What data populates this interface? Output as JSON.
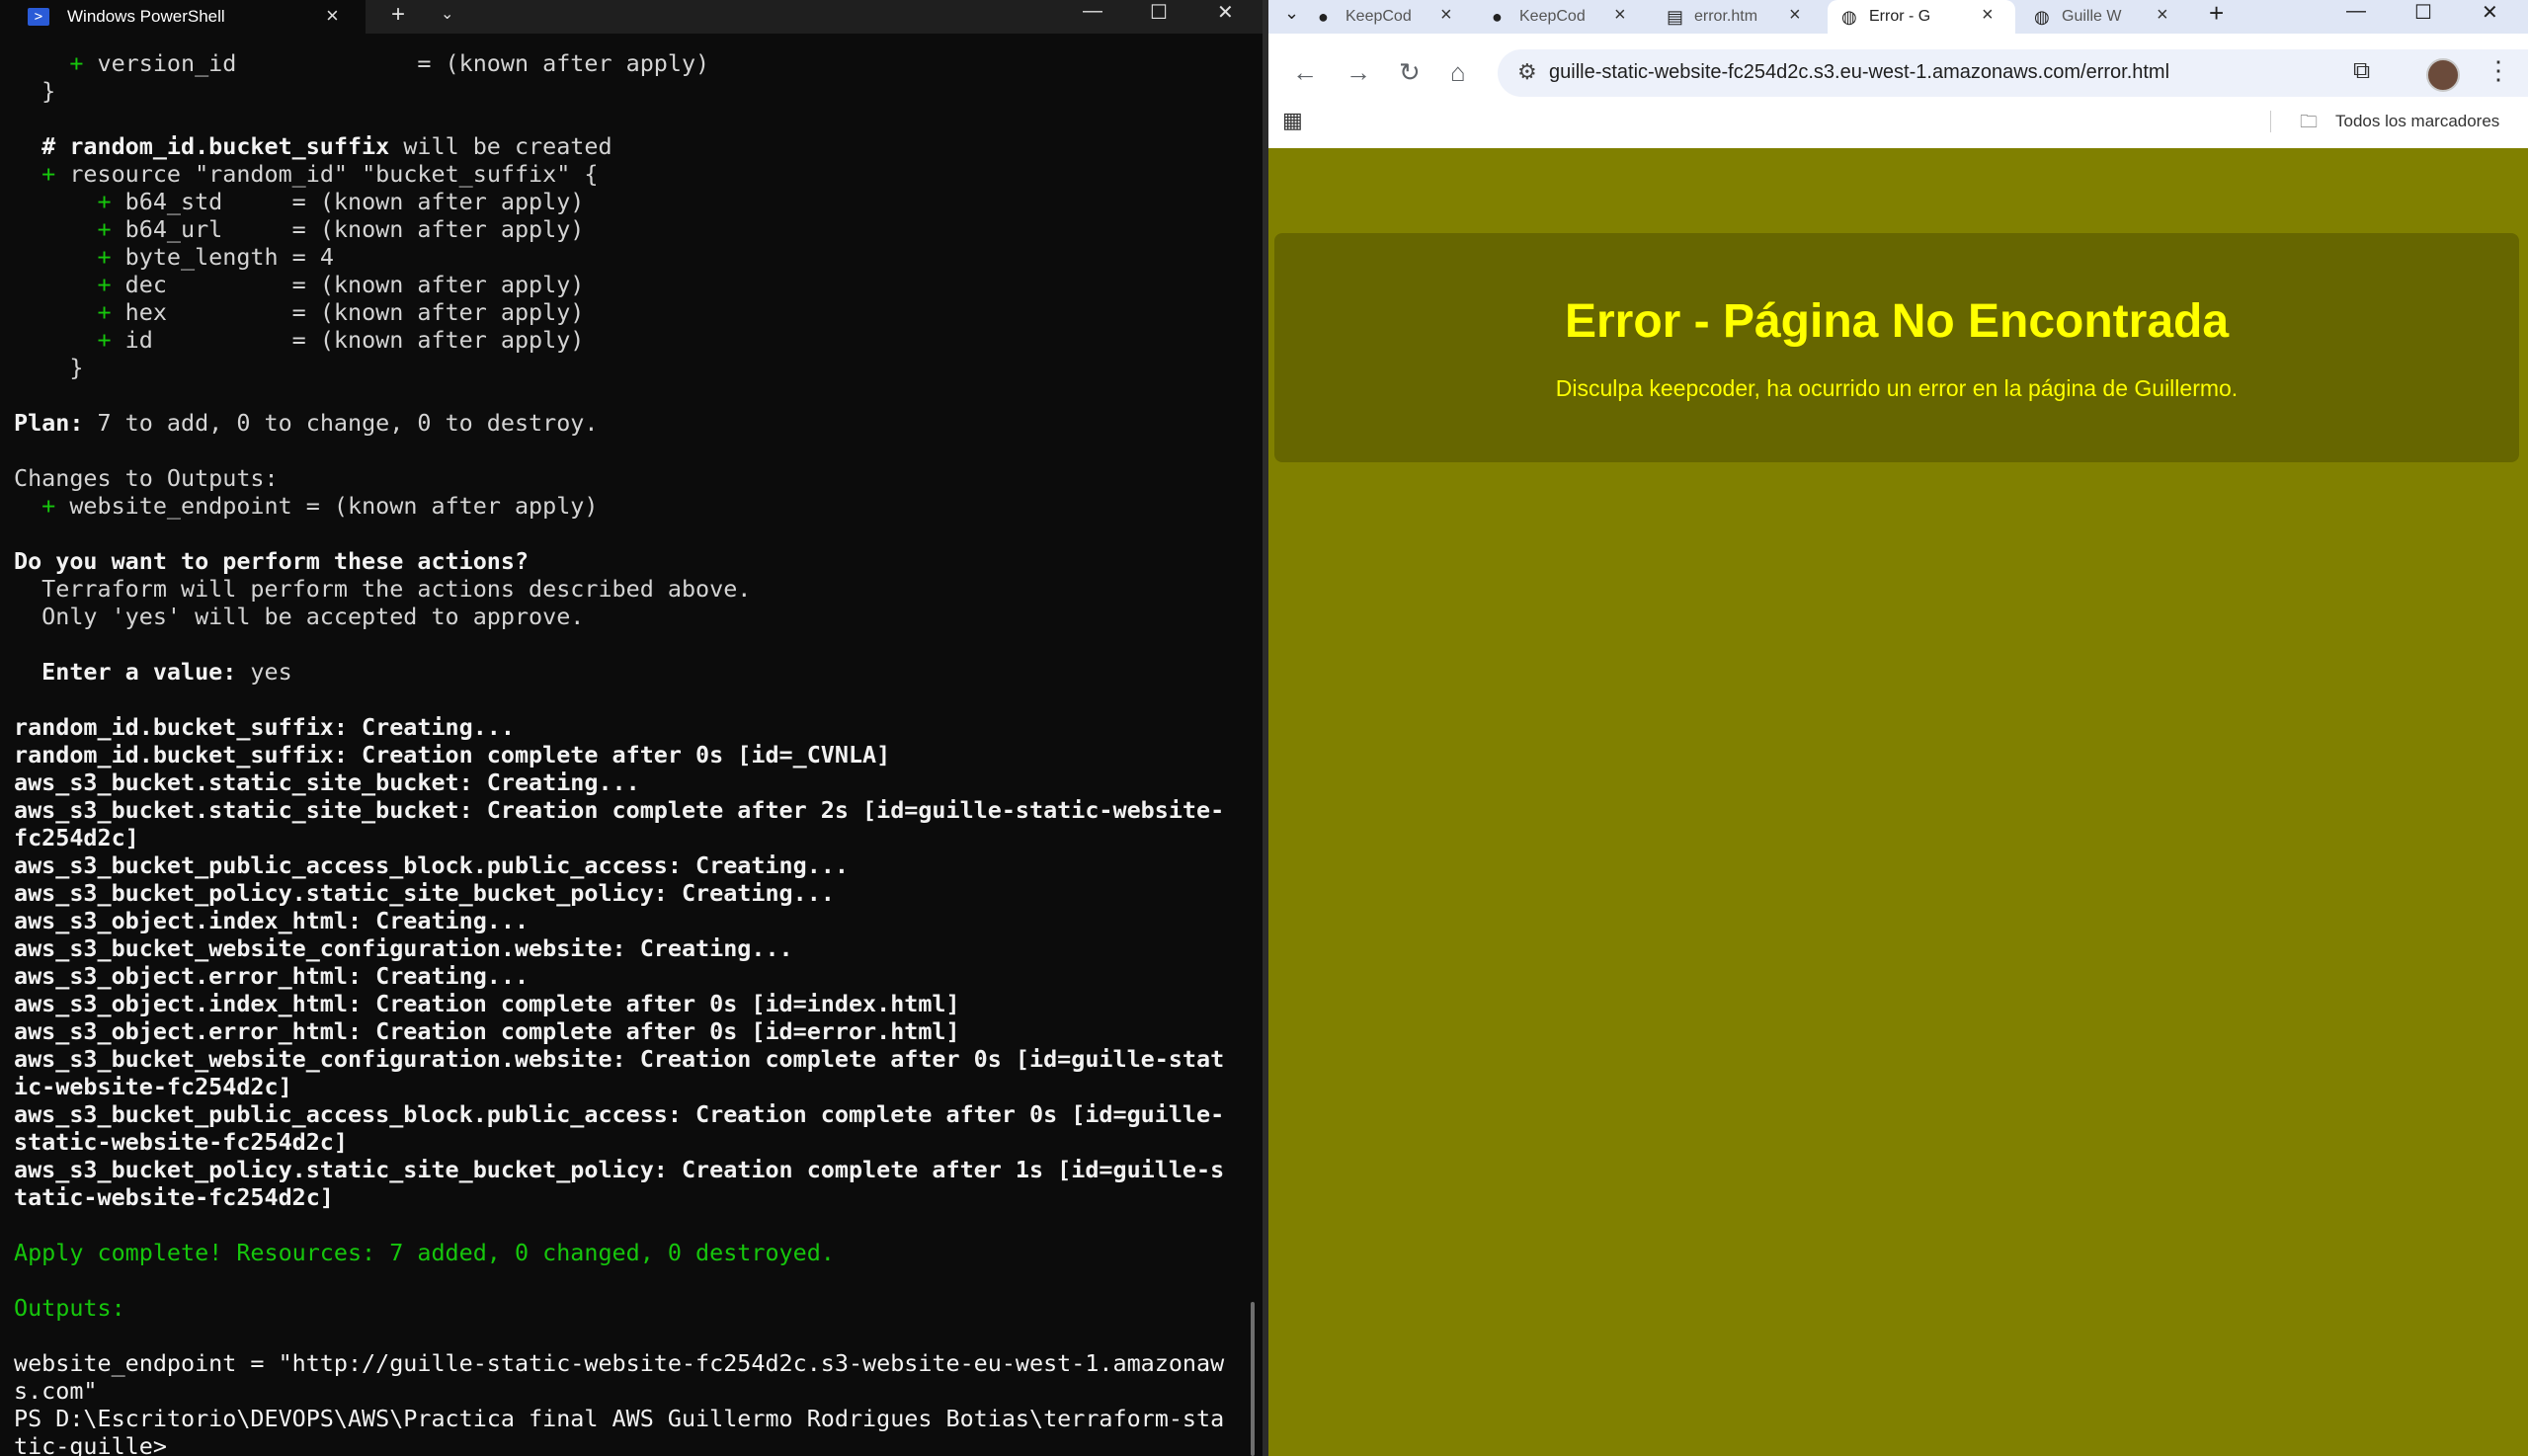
{
  "powershell": {
    "tab_title": "Windows PowerShell",
    "tab_icon": "powershell-icon",
    "controls": {
      "minimize": "—",
      "maximize": "☐",
      "close": "✕"
    },
    "lines": [
      {
        "cls": "",
        "segments": [
          {
            "c": "g",
            "t": "    + "
          },
          {
            "c": "",
            "t": "version_id             = (known after apply)"
          }
        ]
      },
      {
        "cls": "",
        "segments": [
          {
            "c": "",
            "t": "  }"
          }
        ]
      },
      {
        "cls": "",
        "segments": [
          {
            "c": "",
            "t": ""
          }
        ]
      },
      {
        "cls": "",
        "segments": [
          {
            "c": "b",
            "t": "  # random_id.bucket_suffix"
          },
          {
            "c": "",
            "t": " will be created"
          }
        ]
      },
      {
        "cls": "",
        "segments": [
          {
            "c": "g",
            "t": "  + "
          },
          {
            "c": "",
            "t": "resource \"random_id\" \"bucket_suffix\" {"
          }
        ]
      },
      {
        "cls": "",
        "segments": [
          {
            "c": "g",
            "t": "      + "
          },
          {
            "c": "",
            "t": "b64_std     = (known after apply)"
          }
        ]
      },
      {
        "cls": "",
        "segments": [
          {
            "c": "g",
            "t": "      + "
          },
          {
            "c": "",
            "t": "b64_url     = (known after apply)"
          }
        ]
      },
      {
        "cls": "",
        "segments": [
          {
            "c": "g",
            "t": "      + "
          },
          {
            "c": "",
            "t": "byte_length = 4"
          }
        ]
      },
      {
        "cls": "",
        "segments": [
          {
            "c": "g",
            "t": "      + "
          },
          {
            "c": "",
            "t": "dec         = (known after apply)"
          }
        ]
      },
      {
        "cls": "",
        "segments": [
          {
            "c": "g",
            "t": "      + "
          },
          {
            "c": "",
            "t": "hex         = (known after apply)"
          }
        ]
      },
      {
        "cls": "",
        "segments": [
          {
            "c": "g",
            "t": "      + "
          },
          {
            "c": "",
            "t": "id          = (known after apply)"
          }
        ]
      },
      {
        "cls": "",
        "segments": [
          {
            "c": "",
            "t": "    }"
          }
        ]
      },
      {
        "cls": "",
        "segments": [
          {
            "c": "",
            "t": ""
          }
        ]
      },
      {
        "cls": "",
        "segments": [
          {
            "c": "b",
            "t": "Plan:"
          },
          {
            "c": "",
            "t": " 7 to add, 0 to change, 0 to destroy."
          }
        ]
      },
      {
        "cls": "",
        "segments": [
          {
            "c": "",
            "t": ""
          }
        ]
      },
      {
        "cls": "",
        "segments": [
          {
            "c": "",
            "t": "Changes to Outputs:"
          }
        ]
      },
      {
        "cls": "",
        "segments": [
          {
            "c": "g",
            "t": "  + "
          },
          {
            "c": "",
            "t": "website_endpoint = (known after apply)"
          }
        ]
      },
      {
        "cls": "",
        "segments": [
          {
            "c": "",
            "t": ""
          }
        ]
      },
      {
        "cls": "",
        "segments": [
          {
            "c": "b",
            "t": "Do you want to perform these actions?"
          }
        ]
      },
      {
        "cls": "",
        "segments": [
          {
            "c": "",
            "t": "  Terraform will perform the actions described above."
          }
        ]
      },
      {
        "cls": "",
        "segments": [
          {
            "c": "",
            "t": "  Only 'yes' will be accepted to approve."
          }
        ]
      },
      {
        "cls": "",
        "segments": [
          {
            "c": "",
            "t": ""
          }
        ]
      },
      {
        "cls": "",
        "segments": [
          {
            "c": "b",
            "t": "  Enter a value:"
          },
          {
            "c": "",
            "t": " yes"
          }
        ]
      },
      {
        "cls": "",
        "segments": [
          {
            "c": "",
            "t": ""
          }
        ]
      },
      {
        "cls": "",
        "segments": [
          {
            "c": "b",
            "t": "random_id.bucket_suffix: Creating..."
          }
        ]
      },
      {
        "cls": "",
        "segments": [
          {
            "c": "b",
            "t": "random_id.bucket_suffix: Creation complete after 0s [id=_CVNLA]"
          }
        ]
      },
      {
        "cls": "",
        "segments": [
          {
            "c": "b",
            "t": "aws_s3_bucket.static_site_bucket: Creating..."
          }
        ]
      },
      {
        "cls": "",
        "segments": [
          {
            "c": "b",
            "t": "aws_s3_bucket.static_site_bucket: Creation complete after 2s [id=guille-static-website-"
          }
        ]
      },
      {
        "cls": "",
        "segments": [
          {
            "c": "b",
            "t": "fc254d2c]"
          }
        ]
      },
      {
        "cls": "",
        "segments": [
          {
            "c": "b",
            "t": "aws_s3_bucket_public_access_block.public_access: Creating..."
          }
        ]
      },
      {
        "cls": "",
        "segments": [
          {
            "c": "b",
            "t": "aws_s3_bucket_policy.static_site_bucket_policy: Creating..."
          }
        ]
      },
      {
        "cls": "",
        "segments": [
          {
            "c": "b",
            "t": "aws_s3_object.index_html: Creating..."
          }
        ]
      },
      {
        "cls": "",
        "segments": [
          {
            "c": "b",
            "t": "aws_s3_bucket_website_configuration.website: Creating..."
          }
        ]
      },
      {
        "cls": "",
        "segments": [
          {
            "c": "b",
            "t": "aws_s3_object.error_html: Creating..."
          }
        ]
      },
      {
        "cls": "",
        "segments": [
          {
            "c": "b",
            "t": "aws_s3_object.index_html: Creation complete after 0s [id=index.html]"
          }
        ]
      },
      {
        "cls": "",
        "segments": [
          {
            "c": "b",
            "t": "aws_s3_object.error_html: Creation complete after 0s [id=error.html]"
          }
        ]
      },
      {
        "cls": "",
        "segments": [
          {
            "c": "b",
            "t": "aws_s3_bucket_website_configuration.website: Creation complete after 0s [id=guille-stat"
          }
        ]
      },
      {
        "cls": "",
        "segments": [
          {
            "c": "b",
            "t": "ic-website-fc254d2c]"
          }
        ]
      },
      {
        "cls": "",
        "segments": [
          {
            "c": "b",
            "t": "aws_s3_bucket_public_access_block.public_access: Creation complete after 0s [id=guille-"
          }
        ]
      },
      {
        "cls": "",
        "segments": [
          {
            "c": "b",
            "t": "static-website-fc254d2c]"
          }
        ]
      },
      {
        "cls": "",
        "segments": [
          {
            "c": "b",
            "t": "aws_s3_bucket_policy.static_site_bucket_policy: Creation complete after 1s [id=guille-s"
          }
        ]
      },
      {
        "cls": "",
        "segments": [
          {
            "c": "b",
            "t": "tatic-website-fc254d2c]"
          }
        ]
      },
      {
        "cls": "",
        "segments": [
          {
            "c": "",
            "t": ""
          }
        ]
      },
      {
        "cls": "",
        "segments": [
          {
            "c": "g",
            "t": "Apply complete! Resources: 7 added, 0 changed, 0 destroyed."
          }
        ]
      },
      {
        "cls": "",
        "segments": [
          {
            "c": "",
            "t": ""
          }
        ]
      },
      {
        "cls": "",
        "segments": [
          {
            "c": "g",
            "t": "Outputs:"
          }
        ]
      },
      {
        "cls": "",
        "segments": [
          {
            "c": "",
            "t": ""
          }
        ]
      },
      {
        "cls": "",
        "segments": [
          {
            "c": "w",
            "t": "website_endpoint = \"http://guille-static-website-fc254d2c.s3-website-eu-west-1.amazonaw"
          }
        ]
      },
      {
        "cls": "",
        "segments": [
          {
            "c": "w",
            "t": "s.com\""
          }
        ]
      },
      {
        "cls": "",
        "segments": [
          {
            "c": "w",
            "t": "PS D:\\Escritorio\\DEVOPS\\AWS\\Practica final AWS Guillermo Rodrigues Botias\\terraform-sta"
          }
        ]
      },
      {
        "cls": "",
        "segments": [
          {
            "c": "w",
            "t": "tic-guille> "
          }
        ]
      }
    ]
  },
  "chrome": {
    "tabs": [
      {
        "label": "KeepCod",
        "icon": "github-icon",
        "glyph": "●",
        "active": false
      },
      {
        "label": "KeepCod",
        "icon": "github-icon",
        "glyph": "●",
        "active": false
      },
      {
        "label": "error.htm",
        "icon": "file-icon",
        "glyph": "▤",
        "active": false
      },
      {
        "label": "Error - G",
        "icon": "globe-icon",
        "glyph": "◍",
        "active": true
      },
      {
        "label": "Guille W",
        "icon": "globe-icon",
        "glyph": "◍",
        "active": false
      }
    ],
    "new_tab": "+",
    "tab_search": "⌄",
    "controls": {
      "minimize": "—",
      "maximize": "☐",
      "close": "✕"
    },
    "url": "guille-static-website-fc254d2c.s3.eu-west-1.amazonaws.com/error.html",
    "bookmarks_label": "Todos los marcadores",
    "page": {
      "title": "Error - Página No Encontrada",
      "message": "Disculpa keepcoder, ha ocurrido un error en la página de Guillermo."
    },
    "colors": {
      "page_bg": "#808000",
      "card_bg": "#666600",
      "text": "#ffff00"
    }
  }
}
